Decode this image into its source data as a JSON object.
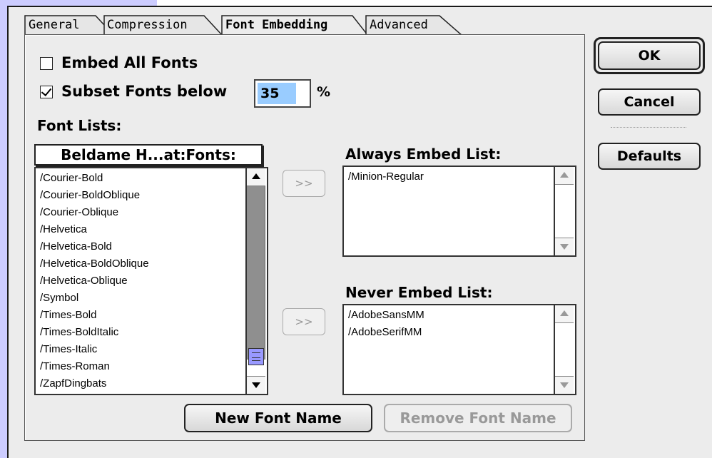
{
  "tabs": [
    {
      "label": "General",
      "active": false
    },
    {
      "label": "Compression",
      "active": false
    },
    {
      "label": "Font Embedding",
      "active": true
    },
    {
      "label": "Advanced",
      "active": false
    }
  ],
  "options": {
    "embed_all_label": "Embed All Fonts",
    "embed_all_checked": false,
    "subset_label": "Subset Fonts below",
    "subset_checked": true,
    "subset_value": "35",
    "percent_sign": "%"
  },
  "font_lists": {
    "heading": "Font Lists:",
    "source_popup": "Beldame H...at:Fonts:",
    "source_items": [
      "/Courier-Bold",
      "/Courier-BoldOblique",
      "/Courier-Oblique",
      "/Helvetica",
      "/Helvetica-Bold",
      "/Helvetica-BoldOblique",
      "/Helvetica-Oblique",
      "/Symbol",
      "/Times-Bold",
      "/Times-BoldItalic",
      "/Times-Italic",
      "/Times-Roman",
      "/ZapfDingbats"
    ],
    "add_button": ">>",
    "always_heading": "Always Embed List:",
    "always_items": [
      "/Minion-Regular"
    ],
    "never_heading": "Never Embed List:",
    "never_items": [
      "/AdobeSansMM",
      "/AdobeSerifMM"
    ]
  },
  "buttons": {
    "new_font_name": "New Font Name",
    "remove_font_name": "Remove Font Name",
    "ok": "OK",
    "cancel": "Cancel",
    "defaults": "Defaults"
  },
  "colors": {
    "selection_highlight": "#99ccff",
    "desktop_accent": "#ccccff",
    "scroll_thumb": "#9999ff"
  }
}
